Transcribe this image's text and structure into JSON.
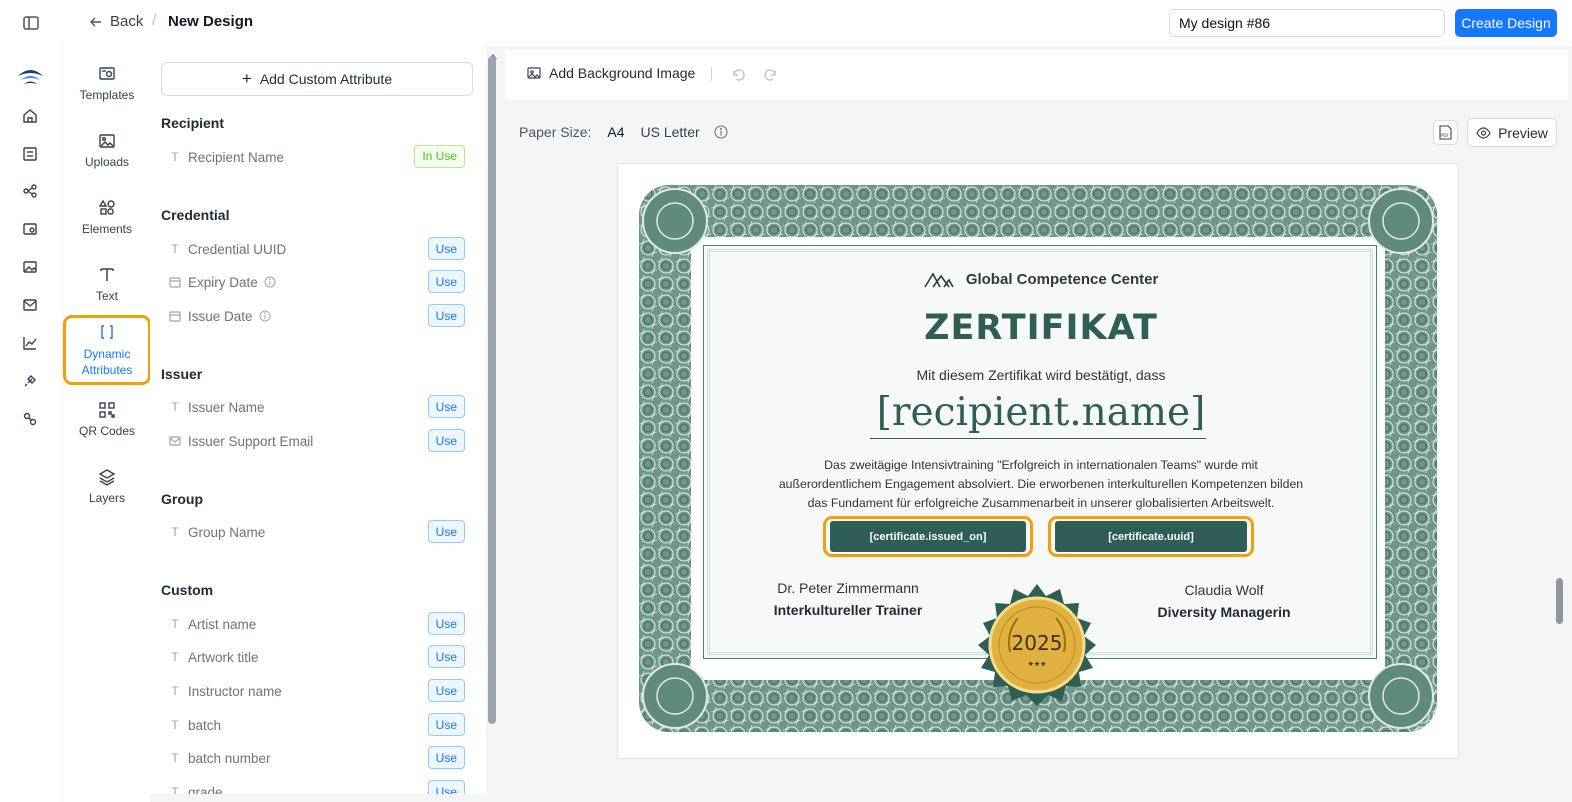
{
  "header": {
    "back_label": "Back",
    "separator": "/",
    "page_title": "New Design",
    "design_name_value": "My design #86",
    "create_label": "Create Design"
  },
  "tools": [
    {
      "label": "Templates",
      "icon": "templates-icon"
    },
    {
      "label": "Uploads",
      "icon": "uploads-icon"
    },
    {
      "label": "Elements",
      "icon": "elements-icon"
    },
    {
      "label": "Text",
      "icon": "text-icon"
    },
    {
      "label_line1": "Dynamic",
      "label_line2": "Attributes",
      "icon": "brackets-icon",
      "active": true
    },
    {
      "label": "QR Codes",
      "icon": "qr-icon"
    },
    {
      "label": "Layers",
      "icon": "layers-icon"
    }
  ],
  "attributes": {
    "add_label": "Add Custom Attribute",
    "use_label": "Use",
    "in_use_label": "In Use",
    "groups": {
      "recipient": {
        "title": "Recipient",
        "items": [
          "Recipient Name"
        ]
      },
      "credential": {
        "title": "Credential",
        "items": [
          "Credential UUID",
          "Expiry Date",
          "Issue Date"
        ]
      },
      "issuer": {
        "title": "Issuer",
        "items": [
          "Issuer Name",
          "Issuer Support Email"
        ]
      },
      "group": {
        "title": "Group",
        "items": [
          "Group Name"
        ]
      },
      "custom": {
        "title": "Custom",
        "items": [
          "Artist name",
          "Artwork title",
          "Instructor name",
          "batch",
          "batch number",
          "grade"
        ]
      }
    }
  },
  "canvas": {
    "bg_label": "Add Background Image",
    "paper_size_label": "Paper Size:",
    "paper_a4": "A4",
    "paper_letter": "US Letter",
    "preview_label": "Preview",
    "pdf_icon_text": "PDF"
  },
  "certificate": {
    "org": "Global Competence Center",
    "title": "ZERTIFIKAT",
    "subtitle": "Mit diesem Zertifikat wird bestätigt, dass",
    "recipient_placeholder": "[recipient.name]",
    "desc_line1": "Das zweitägige Intensivtraining \"Erfolgreich in internationalen Teams\" wurde mit",
    "desc_line2": "außerordentlichem Engagement absolviert. Die erworbenen interkulturellen Kompetenzen bilden",
    "desc_line3": "das Fundament für erfolgreiche Zusammenarbeit in unserer globalisierten Arbeitswelt.",
    "issued_tag": "[certificate.issued_on]",
    "uuid_tag": "[certificate.uuid]",
    "signer_left_name": "Dr. Peter Zimmermann",
    "signer_left_role": "Interkultureller Trainer",
    "signer_right_name": "Claudia Wolf",
    "signer_right_role": "Diversity Managerin",
    "seal_year": "2025",
    "seal_stars": "★★★"
  },
  "colors": {
    "accent": "#1677ff",
    "highlight": "#f59e0b",
    "cert_green": "#2f5e55",
    "gold": "#e0b040"
  }
}
